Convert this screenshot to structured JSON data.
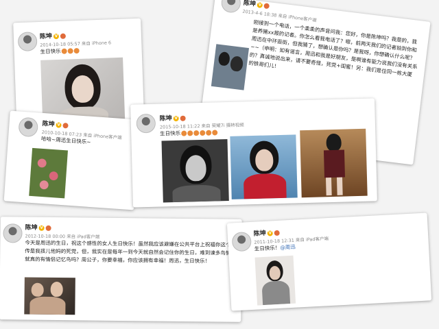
{
  "posts": [
    {
      "author": "陈坤",
      "meta": "2014-10-18 05:57 来自 iPhone 6",
      "text": "生日快乐",
      "emojis": 3
    },
    {
      "author": "陈坤",
      "meta": "2013-4-6 18:38 来自 iPhone客户端",
      "text": "刚接到一个电话，一个柔柔的声音问我：您好，你是陈坤吗？我是的，我是养猪xx报的记者。你怎么看我电话了？嗯，前两天我们的记者拍到你和周迅在中环逛街，但我猜了，想确认是你吗？是我呀，你想确认什么呢？~~（申明：如有谣言，周迅和我是好朋友，是啊谁有能力说我们没有关系的？真诚地说出来，请不要奇怪，死党+闺蜜！另：我们是住同一栋大厦的铁哥们儿！"
    },
    {
      "author": "陈坤",
      "meta": "2010-10-18 07:23 来自 iPhone客户端",
      "text": "哈哈~周迅生日快乐~"
    },
    {
      "author": "陈坤",
      "meta": "2015-10-18 11:22 来自 荣耀7i 摄转视频",
      "text": "生日快乐",
      "emojis": 6
    },
    {
      "author": "陈坤",
      "meta": "2012-10-18 00:00 来自 iPad客户端",
      "text": "今天是周迅的生日，祝这个感性的女人生日快乐！虽然我应该避嫌在公共平台上祝福你这个被传是我孩儿他妈的死党，但，我实在是每年一到今天就自然会记住你的生日，难到谏多鸟情侣就真的有情侣记忆鸟吗？周公子，你要幸福，你应该拥有幸福！周迅，生日快乐！"
    },
    {
      "author": "陈坤",
      "meta": "2011-10-18 12:31 来自 iPad客户端",
      "text": "生日快乐！",
      "mention": "@周迅"
    }
  ]
}
